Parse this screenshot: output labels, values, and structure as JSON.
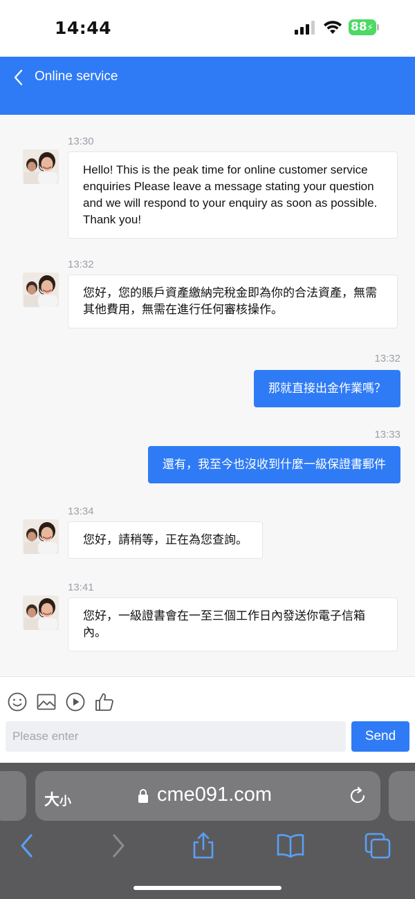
{
  "status_bar": {
    "time": "14:44",
    "battery": "88",
    "icons": [
      "signal-icon",
      "wifi-icon",
      "battery-icon"
    ]
  },
  "header": {
    "title": "Online service",
    "back_icon": "chevron-left-icon",
    "color": "#2f7bf5"
  },
  "messages": [
    {
      "time": "13:30",
      "direction": "incoming",
      "text": "Hello! This is the peak time for online customer service enquiries Please leave a message stating your question and we will respond to your enquiry as soon as possible. Thank you!"
    },
    {
      "time": "13:32",
      "direction": "incoming",
      "text": "您好，您的賬戶資產繳納完稅金即為你的合法資產，無需其他費用，無需在進行任何審核操作。"
    },
    {
      "time": "13:32",
      "direction": "outgoing",
      "text": "那就直接出金作業嗎？"
    },
    {
      "time": "13:33",
      "direction": "outgoing",
      "text": "還有，我至今也沒收到什麼一級保證書郵件"
    },
    {
      "time": "13:34",
      "direction": "incoming",
      "text": "您好，請稍等，正在為您查詢。"
    },
    {
      "time": "13:41",
      "direction": "incoming",
      "text": "您好，一級證書會在一至三個工作日內發送你電子信箱內。"
    }
  ],
  "toolbar": {
    "icons": [
      "emoji-icon",
      "image-icon",
      "video-icon",
      "thumbs-up-icon"
    ],
    "placeholder": "Please enter",
    "send_label": "Send"
  },
  "browser": {
    "text_size_label_big": "大",
    "text_size_label_small": "小",
    "url": "cme091.com",
    "nav_icons": [
      "back-icon",
      "forward-icon",
      "share-icon",
      "bookmarks-icon",
      "tabs-icon"
    ]
  }
}
